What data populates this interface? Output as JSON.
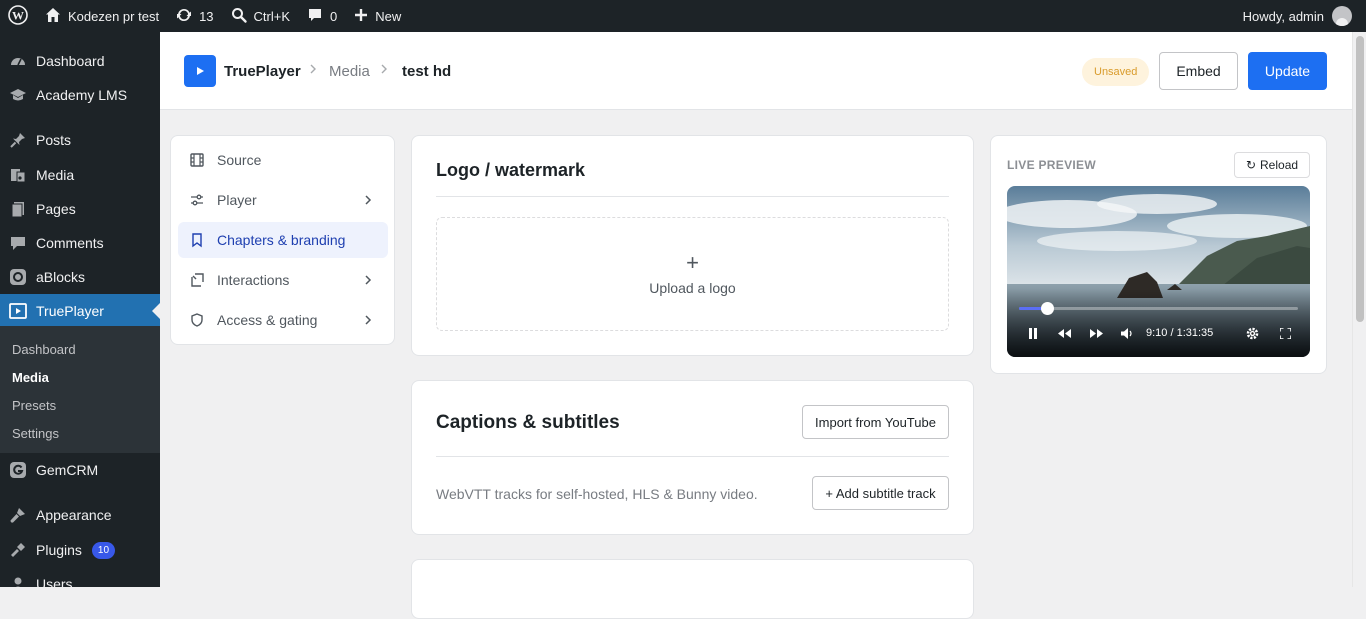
{
  "admin_bar": {
    "site_name": "Kodezen pr test",
    "updates_count": "13",
    "search_shortcut": "Ctrl+K",
    "comments_count": "0",
    "new_label": "New",
    "greeting": "Howdy, admin"
  },
  "sidebar": {
    "menu": [
      {
        "label": "Dashboard",
        "icon": "dashboard-icon"
      },
      {
        "label": "Academy LMS",
        "icon": "graduation-cap-icon"
      },
      {
        "label": "Posts",
        "icon": "pin-icon"
      },
      {
        "label": "Media",
        "icon": "media-icon"
      },
      {
        "label": "Pages",
        "icon": "pages-icon"
      },
      {
        "label": "Comments",
        "icon": "comments-icon"
      },
      {
        "label": "aBlocks",
        "icon": "ablocks-icon"
      },
      {
        "label": "TruePlayer",
        "icon": "trueplayer-icon"
      },
      {
        "label": "GemCRM",
        "icon": "gemcrm-icon"
      },
      {
        "label": "Appearance",
        "icon": "appearance-icon"
      },
      {
        "label": "Plugins",
        "icon": "plugins-icon",
        "badge": "10"
      },
      {
        "label": "Users",
        "icon": "users-icon"
      }
    ],
    "submenu": [
      "Dashboard",
      "Media",
      "Presets",
      "Settings"
    ],
    "active_menu": "TruePlayer",
    "active_submenu": "Media"
  },
  "header": {
    "brand": "TruePlayer",
    "breadcrumb": [
      "Media",
      "test hd"
    ],
    "status": "Unsaved",
    "embed_label": "Embed",
    "update_label": "Update"
  },
  "settings_nav": [
    {
      "label": "Source",
      "icon": "film-icon",
      "has_chevron": false
    },
    {
      "label": "Player",
      "icon": "sliders-icon",
      "has_chevron": true
    },
    {
      "label": "Chapters & branding",
      "icon": "bookmark-icon",
      "has_chevron": false,
      "active": true
    },
    {
      "label": "Interactions",
      "icon": "interactions-icon",
      "has_chevron": true
    },
    {
      "label": "Access & gating",
      "icon": "shield-icon",
      "has_chevron": true
    }
  ],
  "logo_section": {
    "title": "Logo / watermark",
    "upload_plus": "+",
    "upload_label": "Upload a logo"
  },
  "captions_section": {
    "title": "Captions & subtitles",
    "import_label": "Import from YouTube",
    "description": "WebVTT tracks for self-hosted, HLS & Bunny video.",
    "add_track_label": "+ Add subtitle track"
  },
  "live_preview": {
    "title": "LIVE PREVIEW",
    "reload_label": "Reload",
    "reload_icon": "↻",
    "time": "9:10 / 1:31:35",
    "progress_fraction": 0.1
  },
  "colors": {
    "accent": "#1d6ff2",
    "admin_bar": "#1d2327",
    "active_menu": "#2271b1",
    "unsaved_bg": "#fef3dd",
    "unsaved_text": "#d99b2b"
  }
}
